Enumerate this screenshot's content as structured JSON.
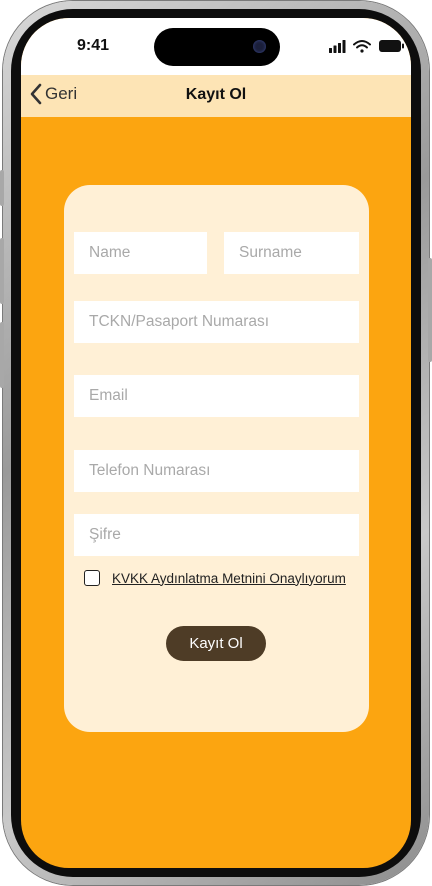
{
  "status_bar": {
    "time": "9:41"
  },
  "nav": {
    "back_label": "Geri",
    "title": "Kayıt Ol"
  },
  "form": {
    "name_placeholder": "Name",
    "surname_placeholder": "Surname",
    "id_placeholder": "TCKN/Pasaport Numarası",
    "email_placeholder": "Email",
    "phone_placeholder": "Telefon Numarası",
    "password_placeholder": "Şifre",
    "kvkk_label": "KVKK Aydınlatma Metnini Onaylıyorum",
    "submit_label": "Kayıt Ol"
  },
  "colors": {
    "background": "#fca510",
    "nav_background": "#fde4b5",
    "card_background": "#fff0d6",
    "button": "#4e3c26"
  }
}
